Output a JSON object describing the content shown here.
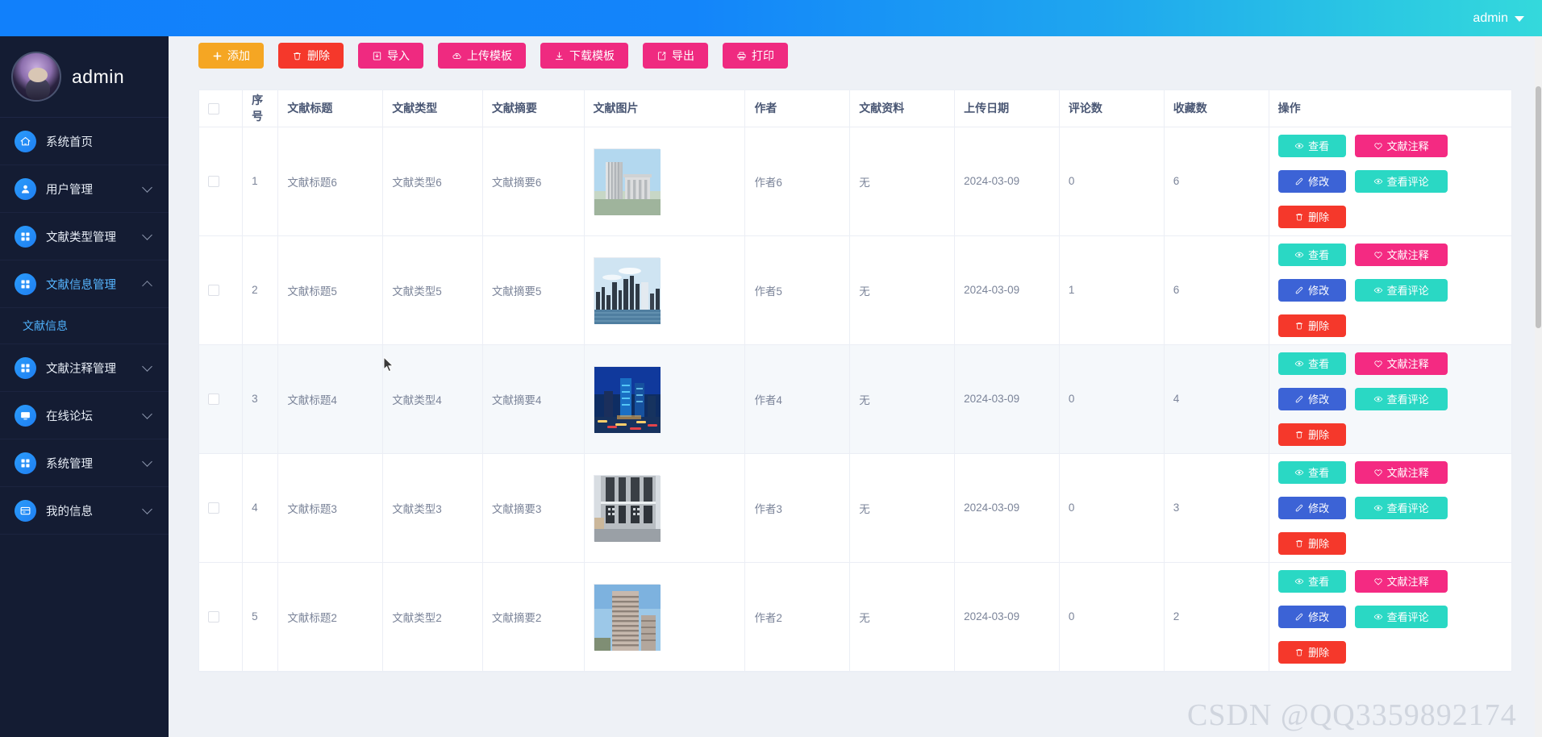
{
  "header": {
    "user_label": "admin",
    "caret_icon": "chevron-down-icon",
    "gradient_from": "#1180fb",
    "gradient_to": "#34d9dc"
  },
  "sidebar": {
    "profile_name": "admin",
    "avatar_icon": "user-avatar",
    "items": [
      {
        "label": "系统首页",
        "icon": "home-icon",
        "expandable": false,
        "expanded": false,
        "active": false
      },
      {
        "label": "用户管理",
        "icon": "user-icon",
        "expandable": true,
        "expanded": false,
        "active": false
      },
      {
        "label": "文献类型管理",
        "icon": "grid-icon",
        "expandable": true,
        "expanded": false,
        "active": false
      },
      {
        "label": "文献信息管理",
        "icon": "grid-icon",
        "expandable": true,
        "expanded": true,
        "active": true
      },
      {
        "label": "文献注释管理",
        "icon": "grid-icon",
        "expandable": true,
        "expanded": false,
        "active": false
      },
      {
        "label": "在线论坛",
        "icon": "monitor-icon",
        "expandable": true,
        "expanded": false,
        "active": false
      },
      {
        "label": "系统管理",
        "icon": "grid-icon",
        "expandable": true,
        "expanded": false,
        "active": false
      },
      {
        "label": "我的信息",
        "icon": "card-icon",
        "expandable": true,
        "expanded": false,
        "active": false
      }
    ],
    "submenu": {
      "label": "文献信息",
      "parent": "文献信息管理"
    }
  },
  "toolbar": {
    "buttons": [
      {
        "label": "添加",
        "icon": "plus-icon",
        "color": "#f5a623"
      },
      {
        "label": "删除",
        "icon": "trash-icon",
        "color": "#f5382b"
      },
      {
        "label": "导入",
        "icon": "import-icon",
        "color": "#ef2a80"
      },
      {
        "label": "上传模板",
        "icon": "cloud-upload-icon",
        "color": "#ef2a80"
      },
      {
        "label": "下载模板",
        "icon": "download-icon",
        "color": "#ef2a80"
      },
      {
        "label": "导出",
        "icon": "export-icon",
        "color": "#ef2a80"
      },
      {
        "label": "打印",
        "icon": "printer-icon",
        "color": "#ef2a80"
      }
    ]
  },
  "table": {
    "select_all_checked": false,
    "columns": [
      "",
      "序号",
      "文献标题",
      "文献类型",
      "文献摘要",
      "文献图片",
      "作者",
      "文献资料",
      "上传日期",
      "评论数",
      "收藏数",
      "操作"
    ],
    "row_actions": [
      {
        "label": "查看",
        "icon": "eye-icon",
        "color": "#2ad8c4"
      },
      {
        "label": "文献注释",
        "icon": "heart-icon",
        "color": "#f42a82"
      },
      {
        "label": "修改",
        "icon": "pencil-icon",
        "color": "#3c63d6"
      },
      {
        "label": "查看评论",
        "icon": "eye-icon",
        "color": "#2ad8c4"
      },
      {
        "label": "删除",
        "icon": "trash-icon",
        "color": "#f5382b"
      }
    ],
    "rows": [
      {
        "checked": false,
        "index": "1",
        "title": "文献标题6",
        "type": "文献类型6",
        "abstract": "文献摘要6",
        "image_alt": "office-tower-photo",
        "author": "作者6",
        "material": "无",
        "upload_date": "2024-03-09",
        "comments": "0",
        "favorites": "6",
        "hovered": false,
        "img_kind": "tower-day"
      },
      {
        "checked": false,
        "index": "2",
        "title": "文献标题5",
        "type": "文献类型5",
        "abstract": "文献摘要5",
        "image_alt": "city-skyline-water-photo",
        "author": "作者5",
        "material": "无",
        "upload_date": "2024-03-09",
        "comments": "1",
        "favorites": "6",
        "hovered": false,
        "img_kind": "skyline-water"
      },
      {
        "checked": false,
        "index": "3",
        "title": "文献标题4",
        "type": "文献类型4",
        "abstract": "文献摘要4",
        "image_alt": "night-city-photo",
        "author": "作者4",
        "material": "无",
        "upload_date": "2024-03-09",
        "comments": "0",
        "favorites": "4",
        "hovered": true,
        "img_kind": "night-city"
      },
      {
        "checked": false,
        "index": "4",
        "title": "文献标题3",
        "type": "文献类型3",
        "abstract": "文献摘要3",
        "image_alt": "modern-facade-photo",
        "author": "作者3",
        "material": "无",
        "upload_date": "2024-03-09",
        "comments": "0",
        "favorites": "3",
        "hovered": false,
        "img_kind": "facade"
      },
      {
        "checked": false,
        "index": "5",
        "title": "文献标题2",
        "type": "文献类型2",
        "abstract": "文献摘要2",
        "image_alt": "residential-tower-photo",
        "author": "作者2",
        "material": "无",
        "upload_date": "2024-03-09",
        "comments": "0",
        "favorites": "2",
        "hovered": false,
        "img_kind": "residential"
      }
    ]
  },
  "watermark": {
    "text": "CSDN @QQ3359892174"
  }
}
